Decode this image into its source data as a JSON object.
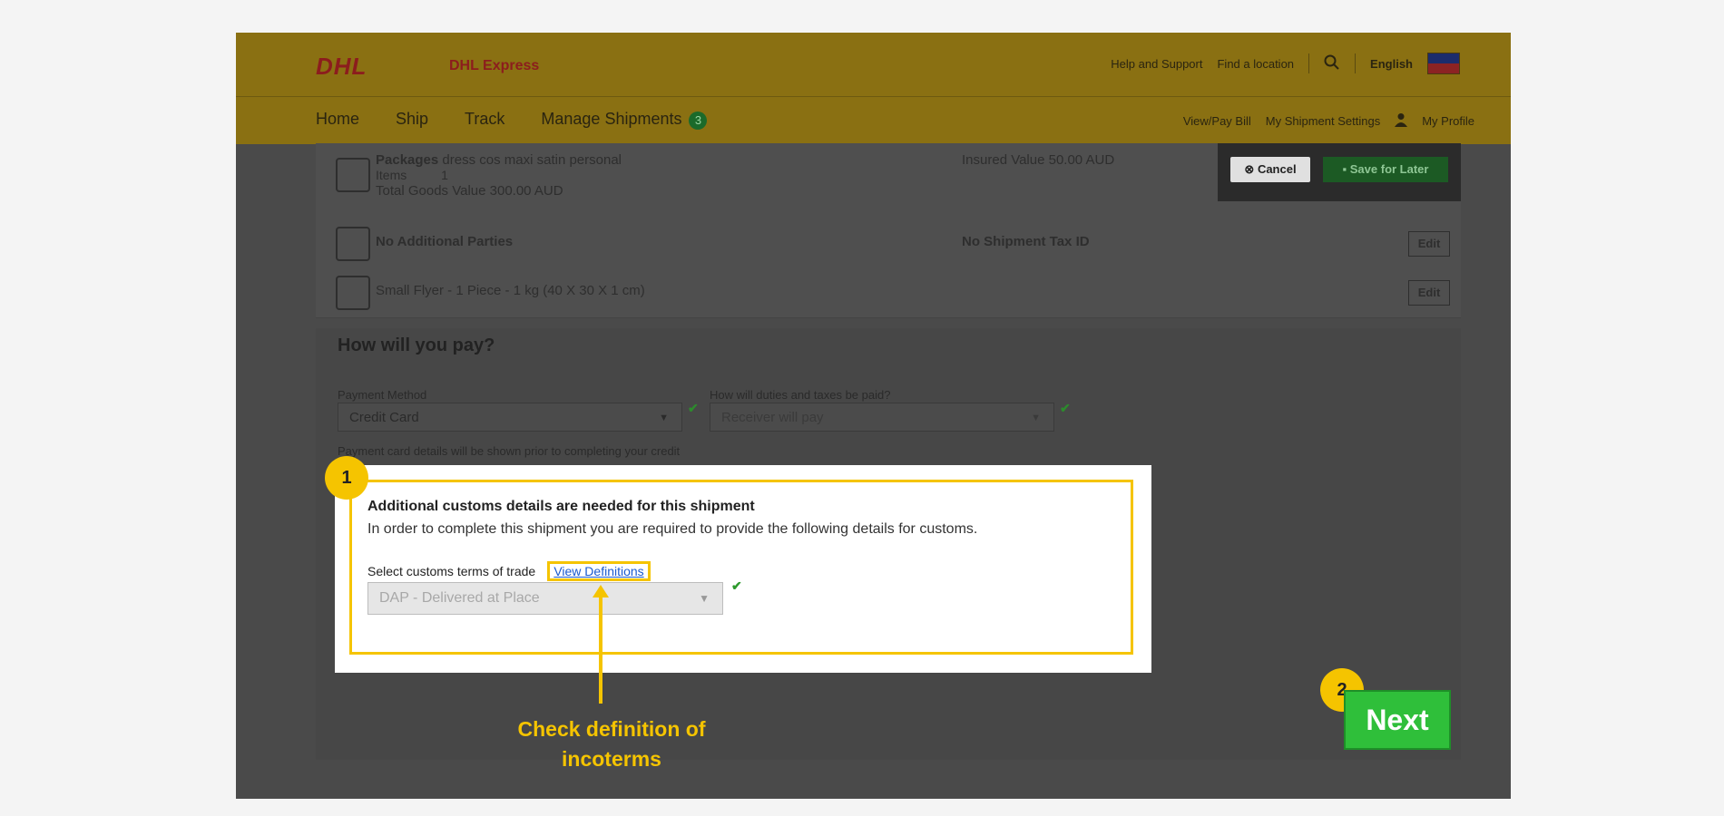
{
  "header": {
    "logo": "DHL",
    "brand": "DHL Express",
    "links": [
      "Help and Support",
      "Find a location"
    ],
    "language": "English"
  },
  "nav": {
    "items": [
      "Home",
      "Ship",
      "Track",
      "Manage Shipments"
    ],
    "badge": "3",
    "right": [
      "View/Pay Bill",
      "My Shipment Settings",
      "My Profile"
    ]
  },
  "summary": {
    "packages_label": "Packages",
    "packages_desc": "dress cos maxi satin personal",
    "items_label": "Items",
    "items_value": "1",
    "total_goods": "Total Goods Value 300.00 AUD",
    "insured": "Insured Value 50.00 AUD",
    "parties": "No Additional Parties",
    "tax_id": "No Shipment Tax ID",
    "package_spec": "Small Flyer - 1 Piece - 1 kg (40 X 30 X 1 cm)",
    "edit_label": "Edit"
  },
  "actions": {
    "cancel": "Cancel",
    "save": "Save for Later"
  },
  "payment": {
    "title": "How will you pay?",
    "method_label": "Payment Method",
    "method_value": "Credit Card",
    "duties_label": "How will duties and taxes be paid?",
    "duties_value": "Receiver will pay",
    "note": "Payment card details will be shown prior to completing your credit"
  },
  "customs_popup": {
    "title": "Additional customs details are needed for this shipment",
    "description": "In order to complete this shipment you are required to provide the following details for customs.",
    "terms_label": "Select customs terms of trade",
    "view_definitions": "View Definitions",
    "terms_value": "DAP - Delivered at Place"
  },
  "annotations": {
    "step1": "1",
    "step2": "2",
    "caption_line1": "Check definition of",
    "caption_line2": "incoterms",
    "next": "Next"
  },
  "colors": {
    "dhl_yellow": "#ffcc00",
    "highlight": "#f5c400",
    "next_green": "#2fbf3a"
  }
}
